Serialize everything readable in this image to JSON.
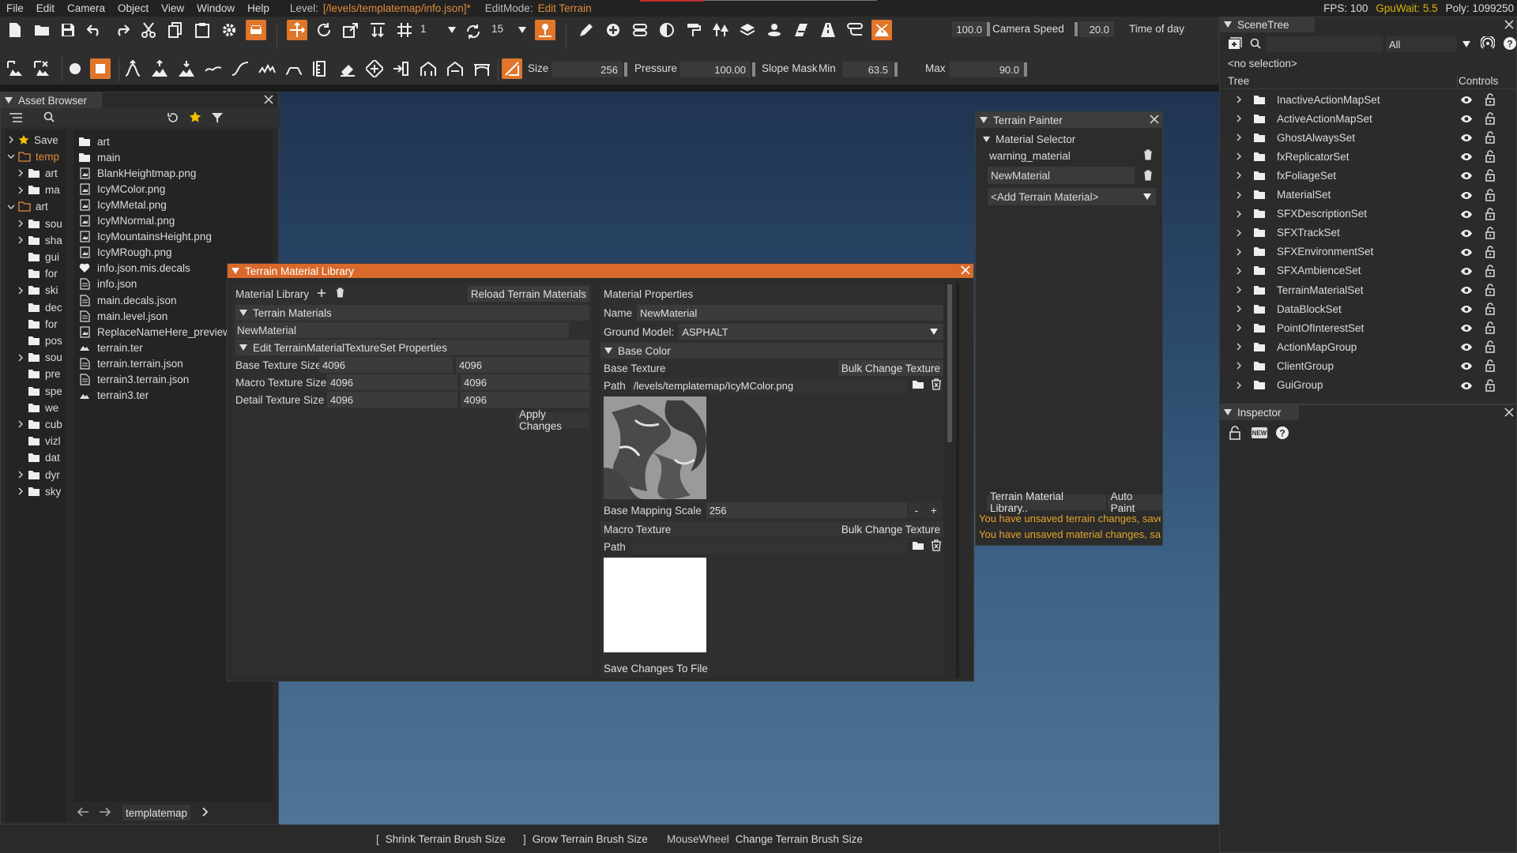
{
  "menubar": {
    "items": [
      "File",
      "Edit",
      "Camera",
      "Object",
      "View",
      "Window",
      "Help"
    ],
    "level_label": "Level:",
    "level_value": "[/levels/templatemap/info.json]*",
    "editmode_label": "EditMode:",
    "editmode_value": "Edit Terrain",
    "fps": "FPS: 100",
    "gpuwait": "GpuWait: 5.5",
    "poly": "Poly: 1099250"
  },
  "toolbar": {
    "snap_count": "1",
    "rotate_count": "15",
    "camera_speed_value": "100.0",
    "camera_speed_label": "Camera Speed",
    "time_value": "20.0",
    "time_label": "Time of day",
    "size_label": "Size",
    "size_value": "256",
    "pressure_label": "Pressure",
    "pressure_value": "100.00",
    "slope_label": "Slope Mask",
    "min_label": "Min",
    "min_value": "63.5",
    "max_label": "Max",
    "max_value": "90.0"
  },
  "asset_browser": {
    "title": "Asset Browser",
    "tree": [
      {
        "label": "Save",
        "icon": "star-icon"
      },
      {
        "label": "temp",
        "icon": "folder-open-icon"
      },
      {
        "label": "art",
        "icon": "folder-icon"
      },
      {
        "label": "ma",
        "icon": "folder-icon"
      },
      {
        "label": "art",
        "icon": "folder-open-icon"
      },
      {
        "label": "sou",
        "icon": "folder-icon"
      },
      {
        "label": "sha",
        "icon": "folder-icon"
      },
      {
        "label": "gui",
        "icon": "folder-icon"
      },
      {
        "label": "for",
        "icon": "folder-icon"
      },
      {
        "label": "ski",
        "icon": "folder-icon"
      },
      {
        "label": "dec",
        "icon": "folder-icon"
      },
      {
        "label": "for",
        "icon": "folder-icon"
      },
      {
        "label": "pos",
        "icon": "folder-icon"
      },
      {
        "label": "sou",
        "icon": "folder-icon"
      },
      {
        "label": "pre",
        "icon": "folder-icon"
      },
      {
        "label": "spe",
        "icon": "folder-icon"
      },
      {
        "label": "we",
        "icon": "folder-icon"
      },
      {
        "label": "cub",
        "icon": "folder-icon"
      },
      {
        "label": "vizl",
        "icon": "folder-icon"
      },
      {
        "label": "dat",
        "icon": "folder-icon"
      },
      {
        "label": "dyr",
        "icon": "folder-icon"
      },
      {
        "label": "sky",
        "icon": "folder-icon"
      }
    ],
    "files": [
      {
        "label": "art",
        "icon": "folder-icon"
      },
      {
        "label": "main",
        "icon": "folder-icon"
      },
      {
        "label": "BlankHeightmap.png",
        "icon": "image-file-icon"
      },
      {
        "label": "IcyMColor.png",
        "icon": "image-file-icon"
      },
      {
        "label": "IcyMMetal.png",
        "icon": "image-file-icon"
      },
      {
        "label": "IcyMNormal.png",
        "icon": "image-file-icon"
      },
      {
        "label": "IcyMountainsHeight.png",
        "icon": "image-file-icon"
      },
      {
        "label": "IcyMRough.png",
        "icon": "image-file-icon"
      },
      {
        "label": "info.json.mis.decals",
        "icon": "heart-icon"
      },
      {
        "label": "info.json",
        "icon": "file-icon"
      },
      {
        "label": "main.decals.json",
        "icon": "file-icon"
      },
      {
        "label": "main.level.json",
        "icon": "file-icon"
      },
      {
        "label": "ReplaceNameHere_preview.jp",
        "icon": "image-file-icon"
      },
      {
        "label": "terrain.ter",
        "icon": "terrain-icon"
      },
      {
        "label": "terrain.terrain.json",
        "icon": "file-icon"
      },
      {
        "label": "terrain3.terrain.json",
        "icon": "file-icon"
      },
      {
        "label": "terrain3.ter",
        "icon": "terrain-icon"
      }
    ],
    "breadcrumb": "templatemap"
  },
  "terrain_painter": {
    "title": "Terrain Painter",
    "section": "Material Selector",
    "materials": [
      "warning_material",
      "NewMaterial"
    ],
    "add_material": "<Add Terrain Material>",
    "library_button": "Terrain Material Library..",
    "autopaint_button": "Auto Paint",
    "warnings": [
      "You have unsaved terrain changes, save",
      "You have unsaved material changes, save"
    ]
  },
  "tml": {
    "title": "Terrain Material Library",
    "library_label": "Material Library",
    "reload_button": "Reload Terrain Materials",
    "terrain_materials_header": "Terrain Materials",
    "selected_material": "NewMaterial",
    "texture_set_header": "Edit TerrainMaterialTextureSet Properties",
    "texture_sizes": [
      {
        "label": "Base Texture Size",
        "a": "4096",
        "b": "4096"
      },
      {
        "label": "Macro Texture Size",
        "a": "4096",
        "b": "4096"
      },
      {
        "label": "Detail Texture Size",
        "a": "4096",
        "b": "4096"
      }
    ],
    "apply_button": "Apply Changes",
    "props_header": "Material Properties",
    "name_label": "Name",
    "name_value": "NewMaterial",
    "ground_label": "Ground Model:",
    "ground_value": "ASPHALT",
    "base_color_header": "Base Color",
    "base_texture_label": "Base Texture",
    "bulk_change": "Bulk Change Texture",
    "path_label": "Path",
    "base_path": "/levels/templatemap/IcyMColor.png",
    "mapping_label": "Base Mapping Scale",
    "mapping_value": "256",
    "minus": "-",
    "plus": "+",
    "macro_label": "Macro Texture",
    "macro_path": "",
    "save_button": "Save Changes To File"
  },
  "scenetree": {
    "title": "SceneTree",
    "filter": "All",
    "selection": "<no selection>",
    "col_tree": "Tree",
    "col_controls": "Controls",
    "items": [
      "InactiveActionMapSet",
      "ActiveActionMapSet",
      "GhostAlwaysSet",
      "fxReplicatorSet",
      "fxFoliageSet",
      "MaterialSet",
      "SFXDescriptionSet",
      "SFXTrackSet",
      "SFXEnvironmentSet",
      "SFXAmbienceSet",
      "TerrainMaterialSet",
      "DataBlockSet",
      "PointOfInterestSet",
      "ActionMapGroup",
      "ClientGroup",
      "GuiGroup"
    ]
  },
  "inspector": {
    "title": "Inspector"
  },
  "bottombar": {
    "hints": [
      {
        "key": "[",
        "action": "Shrink Terrain Brush Size"
      },
      {
        "key": "]",
        "action": "Grow Terrain Brush Size"
      },
      {
        "key": "MouseWheel",
        "action": "Change Terrain Brush Size"
      }
    ]
  },
  "colors": {
    "accent": "#e0762a",
    "warning": "#e8a528",
    "gpu": "#d9b400"
  }
}
